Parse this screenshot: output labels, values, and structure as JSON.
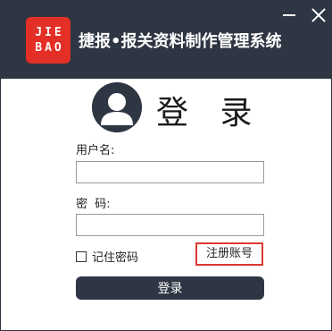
{
  "window": {
    "logo_line1": "JIE",
    "logo_line2": "BAO",
    "title": "捷报•报关资料制作管理系统"
  },
  "login": {
    "heading": "登 录",
    "username_label": "用户名:",
    "username_value": "",
    "password_label": "密  码:",
    "password_value": "",
    "remember_label": "记住密码",
    "register_label": "注册账号",
    "login_button": "登录"
  },
  "colors": {
    "titlebar": "#2f3643",
    "logo": "#e42f26",
    "register_border": "#d93a31"
  }
}
